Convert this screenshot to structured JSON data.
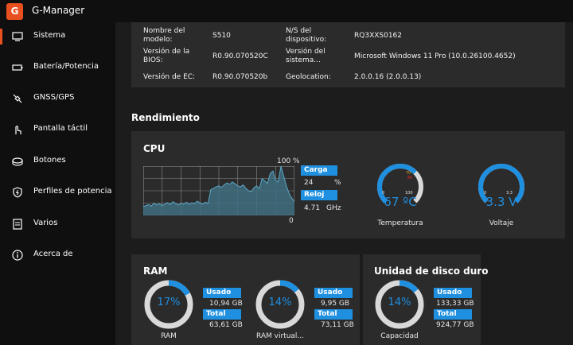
{
  "app": {
    "title": "G-Manager",
    "logo_text": "G"
  },
  "sidebar": {
    "items": [
      {
        "label": "Sistema",
        "icon": "monitor-icon",
        "active": true
      },
      {
        "label": "Batería/Potencia",
        "icon": "battery-icon"
      },
      {
        "label": "GNSS/GPS",
        "icon": "satellite-icon"
      },
      {
        "label": "Pantalla táctil",
        "icon": "touch-icon"
      },
      {
        "label": "Botones",
        "icon": "buttons-icon"
      },
      {
        "label": "Perfiles de potencia",
        "icon": "shield-icon"
      },
      {
        "label": "Varios",
        "icon": "list-icon"
      },
      {
        "label": "Acerca de",
        "icon": "info-icon"
      }
    ]
  },
  "system_info": {
    "model_label": "Nombre del modelo:",
    "model_value": "S510",
    "serial_label": "N/S del dispositivo:",
    "serial_value": "RQ3XXS0162",
    "bios_label": "Versión de la BIOS:",
    "bios_value": "R0.90.070520C",
    "os_label": "Versión del sistema...",
    "os_value": "Microsoft Windows 11 Pro (10.0.26100.4652)",
    "ec_label": "Versión de EC:",
    "ec_value": "R0.90.070520b",
    "geo_label": "Geolocation:",
    "geo_value": "2.0.0.16 (2.0.0.13)"
  },
  "performance": {
    "title": "Rendimiento",
    "cpu": {
      "title": "CPU",
      "max_label": "100 %",
      "min_label": "0",
      "load_label": "Carga",
      "load_value": "24",
      "load_unit": "%",
      "clock_label": "Reloj",
      "clock_value": "4.71",
      "clock_unit": "GHz",
      "history": [
        18,
        20,
        22,
        19,
        25,
        21,
        24,
        20,
        23,
        26,
        22,
        28,
        24,
        21,
        25,
        23,
        27,
        22,
        26,
        24,
        29,
        25,
        23,
        27,
        24,
        52,
        55,
        58,
        60,
        57,
        62,
        66,
        63,
        68,
        64,
        60,
        58,
        62,
        55,
        50,
        48,
        56,
        60,
        54,
        75,
        70,
        65,
        85,
        90,
        72,
        68,
        100,
        80,
        60,
        45,
        35,
        28
      ]
    },
    "temperature": {
      "value": "67 ºC",
      "label": "Temperatura",
      "min": "0",
      "max": "100",
      "mark1": "70",
      "mark2": "80",
      "fraction": 0.67
    },
    "voltage": {
      "value": "3.3 V",
      "label": "Voltaje",
      "min": "0",
      "max": "3.3",
      "fraction": 1.0
    }
  },
  "ram": {
    "title": "RAM",
    "physical": {
      "percent_text": "17%",
      "fraction": 0.17,
      "used_label": "Usado",
      "used_value": "10,94 GB",
      "total_label": "Total",
      "total_value": "63,61 GB",
      "caption": "RAM"
    },
    "virtual": {
      "percent_text": "14%",
      "fraction": 0.14,
      "used_label": "Usado",
      "used_value": "9,95 GB",
      "total_label": "Total",
      "total_value": "73,11 GB",
      "caption": "RAM virtual..."
    }
  },
  "disk": {
    "title": "Unidad de disco duro",
    "percent_text": "14%",
    "fraction": 0.14,
    "used_label": "Usado",
    "used_value": "133,33 GB",
    "total_label": "Total",
    "total_value": "924,77 GB",
    "caption": "Capacidad"
  },
  "colors": {
    "accent": "#e8501f",
    "blue": "#1f8fe0",
    "gauge_track": "#d9d9d9",
    "chart_fill": "#3f6f80"
  }
}
